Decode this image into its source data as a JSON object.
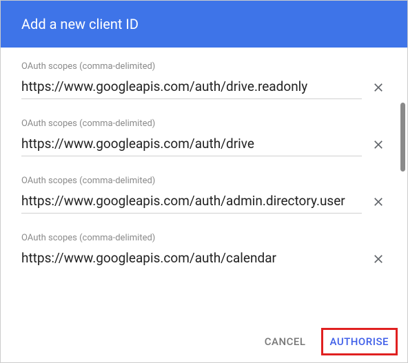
{
  "header": {
    "title": "Add a new client ID"
  },
  "fields": [
    {
      "label": "OAuth scopes (comma-delimited)",
      "value": "https://www.googleapis.com/auth/drive.readonly"
    },
    {
      "label": "OAuth scopes (comma-delimited)",
      "value": "https://www.googleapis.com/auth/drive"
    },
    {
      "label": "OAuth scopes (comma-delimited)",
      "value": "https://www.googleapis.com/auth/admin.directory.user"
    },
    {
      "label": "OAuth scopes (comma-delimited)",
      "value": "https://www.googleapis.com/auth/calendar"
    }
  ],
  "footer": {
    "cancel": "CANCEL",
    "authorise": "AUTHORISE"
  }
}
